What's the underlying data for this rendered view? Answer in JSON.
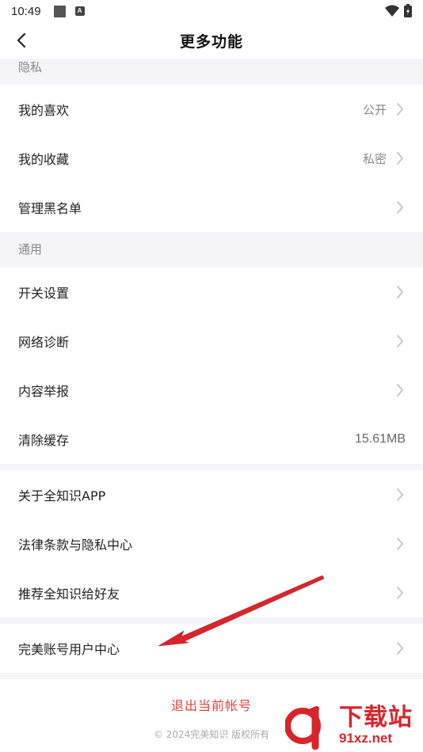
{
  "status_bar": {
    "time": "10:49",
    "a_icon_text": "A"
  },
  "header": {
    "title": "更多功能"
  },
  "sections": {
    "privacy": {
      "title": "隐私",
      "items": [
        {
          "label": "我的喜欢",
          "value": "公开"
        },
        {
          "label": "我的收藏",
          "value": "私密"
        },
        {
          "label": "管理黑名单",
          "value": ""
        }
      ]
    },
    "general": {
      "title": "通用",
      "items": [
        {
          "label": "开关设置",
          "value": ""
        },
        {
          "label": "网络诊断",
          "value": ""
        },
        {
          "label": "内容举报",
          "value": ""
        },
        {
          "label": "清除缓存",
          "value": "15.61MB"
        }
      ]
    },
    "about": {
      "items": [
        {
          "label": "关于全知识APP"
        },
        {
          "label": "法律条款与隐私中心"
        },
        {
          "label": "推荐全知识给好友"
        }
      ]
    },
    "account": {
      "items": [
        {
          "label": "完美账号用户中心"
        }
      ]
    }
  },
  "footer": {
    "logout_label": "退出当前帐号",
    "copyright": "© 2024完美知识 版权所有"
  },
  "watermark": {
    "logo_text": "91",
    "cn": "下载站",
    "url": "91xz.net"
  },
  "colors": {
    "accent_red": "#e0443a",
    "arrow_red": "#d8252b"
  }
}
